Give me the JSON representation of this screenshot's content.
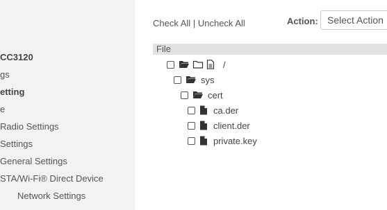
{
  "sidebar": {
    "items": [
      {
        "label": "CC3120",
        "bold": true
      },
      {
        "label": "gs",
        "bold": false
      },
      {
        "label": "etting",
        "bold": true
      },
      {
        "label": "e",
        "bold": false
      },
      {
        "label": "Radio Settings",
        "bold": false
      },
      {
        "label": "Settings",
        "bold": false
      },
      {
        "label": "General Settings",
        "bold": false
      },
      {
        "label": "STA/Wi-Fi® Direct Device",
        "bold": false
      },
      {
        "label": "Network Settings",
        "bold": false
      }
    ]
  },
  "toolbar": {
    "check_all": "Check All",
    "separator": "|",
    "uncheck_all": "Uncheck All",
    "action_label": "Action:",
    "action_select_value": "Select Action"
  },
  "file_table": {
    "header": "File",
    "tree": [
      {
        "name": "/",
        "type": "root"
      },
      {
        "name": "sys",
        "type": "folder"
      },
      {
        "name": "cert",
        "type": "folder"
      },
      {
        "name": "ca.der",
        "type": "file"
      },
      {
        "name": "client.der",
        "type": "file"
      },
      {
        "name": "private.key",
        "type": "file"
      }
    ]
  }
}
